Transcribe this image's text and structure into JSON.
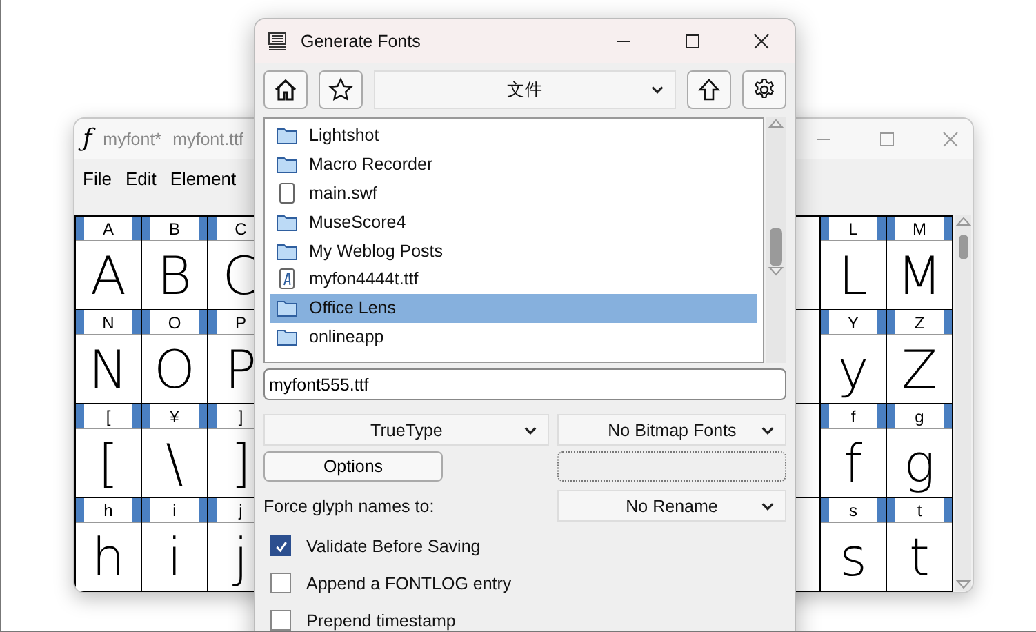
{
  "font_window": {
    "icon": "ƒ",
    "title": "myfont*",
    "filename": "myfont.ttf",
    "menu": [
      "File",
      "Edit",
      "Element"
    ],
    "left_rows": [
      [
        {
          "label": "A",
          "glyph": "A"
        },
        {
          "label": "B",
          "glyph": "B"
        },
        {
          "label": "C",
          "glyph": "C"
        }
      ],
      [
        {
          "label": "N",
          "glyph": "N"
        },
        {
          "label": "O",
          "glyph": "O"
        },
        {
          "label": "P",
          "glyph": "P"
        }
      ],
      [
        {
          "label": "[",
          "glyph": "["
        },
        {
          "label": "¥",
          "glyph": "\\"
        },
        {
          "label": "]",
          "glyph": "]"
        }
      ],
      [
        {
          "label": "h",
          "glyph": "h"
        },
        {
          "label": "i",
          "glyph": "i"
        },
        {
          "label": "j",
          "glyph": "j"
        }
      ]
    ],
    "right_rows": [
      [
        {
          "label": "L",
          "glyph": "L"
        },
        {
          "label": "M",
          "glyph": "M"
        }
      ],
      [
        {
          "label": "Y",
          "glyph": "y"
        },
        {
          "label": "Z",
          "glyph": "Z"
        }
      ],
      [
        {
          "label": "f",
          "glyph": "f"
        },
        {
          "label": "g",
          "glyph": "g"
        }
      ],
      [
        {
          "label": "s",
          "glyph": "s"
        },
        {
          "label": "t",
          "glyph": "t"
        }
      ]
    ]
  },
  "dialog": {
    "title": "Generate Fonts",
    "folder": "文件",
    "files": [
      {
        "name": "Lightshot",
        "kind": "folder",
        "selected": false
      },
      {
        "name": "Macro Recorder",
        "kind": "folder",
        "selected": false
      },
      {
        "name": "main.swf",
        "kind": "file",
        "selected": false
      },
      {
        "name": "MuseScore4",
        "kind": "folder",
        "selected": false
      },
      {
        "name": "My Weblog Posts",
        "kind": "folder",
        "selected": false
      },
      {
        "name": "myfon4444t.ttf",
        "kind": "font",
        "selected": false
      },
      {
        "name": "Office Lens",
        "kind": "folder",
        "selected": true
      },
      {
        "name": "onlineapp",
        "kind": "folder",
        "selected": false
      }
    ],
    "filename": "myfont555.ttf",
    "format": "TrueType",
    "bitmap": "No Bitmap Fonts",
    "options_button": "Options",
    "force_label": "Force glyph names to:",
    "rename": "No Rename",
    "checkboxes": [
      {
        "label": "Validate Before Saving",
        "checked": true
      },
      {
        "label": "Append a FONTLOG entry",
        "checked": false
      },
      {
        "label": "Prepend timestamp",
        "checked": false
      }
    ]
  }
}
